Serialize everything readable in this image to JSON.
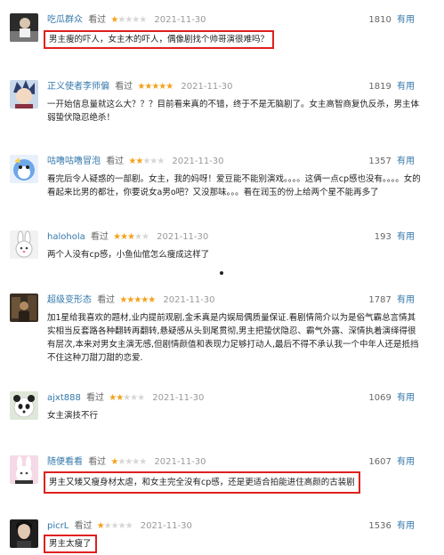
{
  "rated_label": "看过",
  "useful_label": "有用",
  "reviews": [
    {
      "user": "吃瓜群众",
      "stars": 1,
      "date": "2021-11-30",
      "votes": "1810",
      "text": "男主瘦的吓人，女主木的吓人，偶像剧找个帅哥演很难吗？",
      "highlighted": true,
      "avatar": "dark-figure-avatar"
    },
    {
      "user": "正义使者李师偏",
      "stars": 5,
      "date": "2021-11-30",
      "votes": "1819",
      "text": "一开始信息量就这么大？？？目前看来真的不错，终于不是无脑剧了。女主高智商复仇反杀，男主体弱蛰伏隐忍绝杀！",
      "highlighted": false,
      "avatar": "anime-boy-avatar"
    },
    {
      "user": "咕噜咕噜冒泡",
      "stars": 2,
      "date": "2021-11-30",
      "votes": "1357",
      "text": "看完后令人疑惑的一部剧。女主，我的妈呀！爱豆能不能别演戏。。。。这俩一点cp感也没有。。。。女的看起来比男的都壮，你要说女a男o吧？又没那味。。。看在润玉的份上给两个星不能再多了",
      "highlighted": false,
      "avatar": "blue-cartoon-avatar"
    },
    {
      "user": "halohola",
      "stars": 3,
      "date": "2021-11-30",
      "votes": "193",
      "text": "两个人没有cp感，小鱼仙倌怎么瘦成这样了",
      "highlighted": false,
      "avatar": "bunny-avatar"
    },
    {
      "user": "超级变形态",
      "stars": 5,
      "date": "2021-11-30",
      "votes": "1787",
      "text": "加1星给我喜欢的题材,业内提前观剧,金禾真是内娱局偶质量保证.看剧情简介以为是俗气霸总言情其实相当反套路各种翻转再翻转,悬疑感从头到尾贯彻,男主把蛰伏隐忍、霸气外露、深情执着演绎得很有层次,本来对男女主演无感,但剧情颜值和表现力足够打动人,最后不得不承认我一个中年人还是抵挡不住这种刀甜刀甜的恋爱.",
      "highlighted": false,
      "avatar": "dark-scene-avatar"
    },
    {
      "user": "ajxt888",
      "stars": 2,
      "date": "2021-11-30",
      "votes": "1069",
      "text": "女主演技不行",
      "highlighted": false,
      "avatar": "panda-avatar"
    },
    {
      "user": "随便看看",
      "stars": 1,
      "date": "2021-11-30",
      "votes": "1607",
      "text": "男主又矮又瘦身材太虐，和女主完全没有cp感，还是更适合拍能进住高颜的古装剧",
      "highlighted": true,
      "avatar": "pink-rabbit-avatar"
    },
    {
      "user": "picrL",
      "stars": 1,
      "date": "2021-11-30",
      "votes": "1536",
      "text": "男主太瘦了",
      "highlighted": true,
      "avatar": "portrait-avatar"
    }
  ]
}
